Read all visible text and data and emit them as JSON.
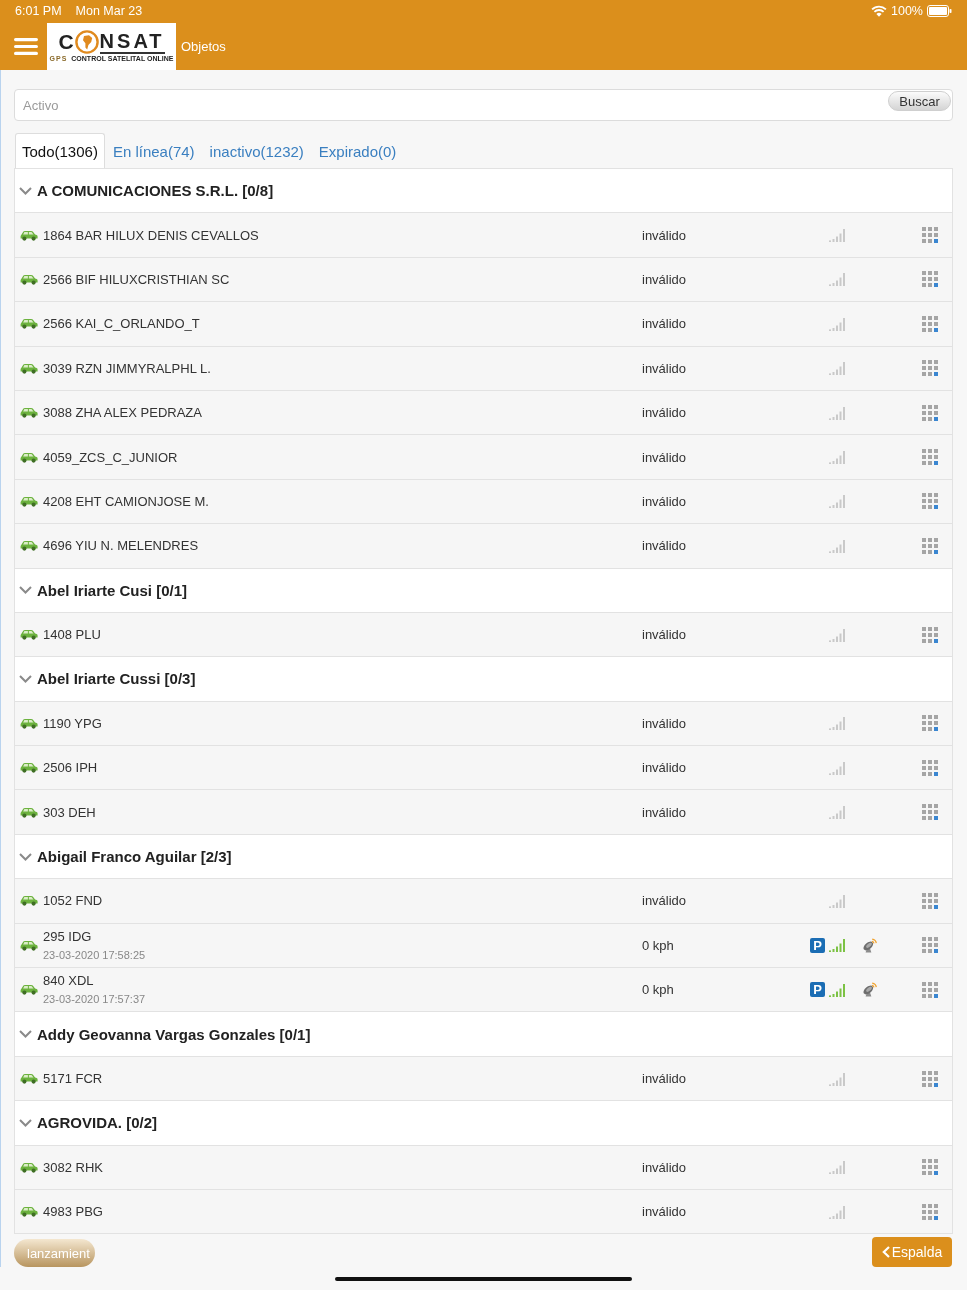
{
  "status_bar": {
    "time": "6:01 PM",
    "date": "Mon Mar 23",
    "battery": "100%"
  },
  "header": {
    "logo": {
      "letter": "C",
      "wordmark": "NSAT",
      "mark": "GPS",
      "tagline": "CONTROL SATELITAL ONLINE"
    },
    "title": "Objetos"
  },
  "search": {
    "placeholder": "Activo",
    "button": "Buscar"
  },
  "tabs": [
    {
      "label": "Todo(1306)",
      "selected": true
    },
    {
      "label": "En línea(74)",
      "selected": false
    },
    {
      "label": "inactivo(1232)",
      "selected": false
    },
    {
      "label": "Expirado(0)",
      "selected": false
    }
  ],
  "groups": [
    {
      "title": "A COMUNICACIONES S.R.L. [0/8]",
      "expanded": true,
      "objects": [
        {
          "name": "1864 BAR HILUX DENIS CEVALLOS",
          "status": "inválido",
          "online": false
        },
        {
          "name": "2566 BIF HILUXCRISTHIAN SC",
          "status": "inválido",
          "online": false
        },
        {
          "name": "2566 KAI_C_ORLANDO_T",
          "status": "inválido",
          "online": false
        },
        {
          "name": "3039 RZN JIMMYRALPHL L.",
          "status": "inválido",
          "online": false
        },
        {
          "name": "3088 ZHA ALEX PEDRAZA",
          "status": "inválido",
          "online": false
        },
        {
          "name": "4059_ZCS_C_JUNIOR",
          "status": "inválido",
          "online": false
        },
        {
          "name": "4208 EHT CAMIONJOSE M.",
          "status": "inválido",
          "online": false
        },
        {
          "name": "4696 YIU N. MELENDRES",
          "status": "inválido",
          "online": false
        }
      ]
    },
    {
      "title": "Abel Iriarte Cusi [0/1]",
      "expanded": true,
      "objects": [
        {
          "name": "1408 PLU",
          "status": "inválido",
          "online": false
        }
      ]
    },
    {
      "title": "Abel Iriarte Cussi [0/3]",
      "expanded": true,
      "objects": [
        {
          "name": "1190 YPG",
          "status": "inválido",
          "online": false
        },
        {
          "name": "2506 IPH",
          "status": "inválido",
          "online": false
        },
        {
          "name": "303 DEH",
          "status": "inválido",
          "online": false
        }
      ]
    },
    {
      "title": "Abigail Franco Aguilar [2/3]",
      "expanded": true,
      "objects": [
        {
          "name": "1052 FND",
          "status": "inválido",
          "online": false
        },
        {
          "name": "295 IDG",
          "time": "23-03-2020 17:58:25",
          "status": "0 kph",
          "parking_badge": "P",
          "online": true
        },
        {
          "name": "840 XDL",
          "time": "23-03-2020 17:57:37",
          "status": "0 kph",
          "parking_badge": "P",
          "online": true
        }
      ]
    },
    {
      "title": "Addy Geovanna Vargas Gonzales [0/1]",
      "expanded": true,
      "objects": [
        {
          "name": "5171 FCR",
          "status": "inválido",
          "online": false
        }
      ]
    },
    {
      "title": "AGROVIDA. [0/2]",
      "expanded": true,
      "objects": [
        {
          "name": "3082 RHK",
          "status": "inválido",
          "online": false
        },
        {
          "name": "4983 PBG",
          "status": "inválido",
          "online": false
        }
      ]
    }
  ],
  "footer": {
    "launch_button": "lanzamient",
    "back_button": "Espalda"
  }
}
